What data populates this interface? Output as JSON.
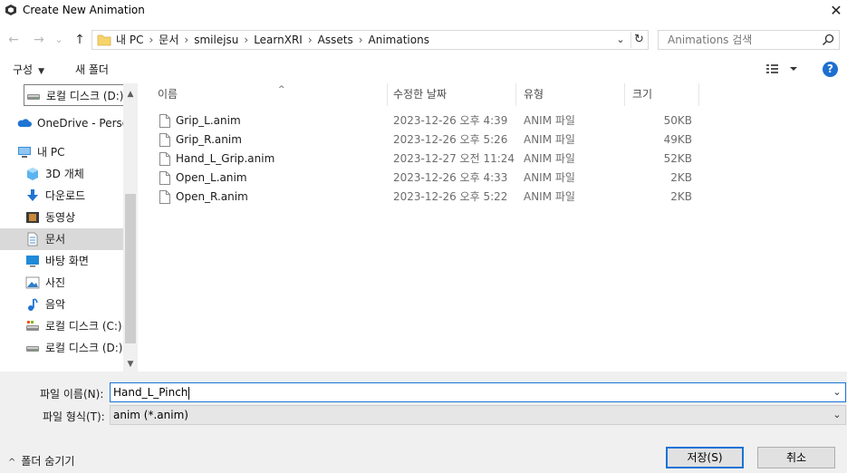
{
  "window": {
    "title": "Create New Animation",
    "close_glyph": "✕"
  },
  "nav": {
    "back_glyph": "←",
    "forward_glyph": "→",
    "recent_glyph": "⌄",
    "up_glyph": "↑",
    "breadcrumbs": [
      "내 PC",
      "문서",
      "smilejsu",
      "LearnXRI",
      "Assets",
      "Animations"
    ],
    "separator": "›",
    "dropdown_glyph": "⌄",
    "refresh_glyph": "↻",
    "search_placeholder": "Animations 검색"
  },
  "toolbar": {
    "organize_label": "구성",
    "organize_caret": "▼",
    "new_folder_label": "새 폴더",
    "help_label": "?"
  },
  "sidebar": {
    "items": [
      {
        "label": "로컬 디스크 (D:)",
        "icon": "drive-icon",
        "state": "hovered"
      },
      {
        "label": "OneDrive - Personal",
        "icon": "onedrive-icon",
        "state": ""
      },
      {
        "label": "내 PC",
        "icon": "pc-icon",
        "state": ""
      },
      {
        "label": "3D 개체",
        "icon": "3d-objects-icon",
        "state": ""
      },
      {
        "label": "다운로드",
        "icon": "download-icon",
        "state": ""
      },
      {
        "label": "동영상",
        "icon": "video-icon",
        "state": ""
      },
      {
        "label": "문서",
        "icon": "documents-icon",
        "state": "selected"
      },
      {
        "label": "바탕 화면",
        "icon": "desktop-icon",
        "state": ""
      },
      {
        "label": "사진",
        "icon": "pictures-icon",
        "state": ""
      },
      {
        "label": "음악",
        "icon": "music-icon",
        "state": ""
      },
      {
        "label": "로컬 디스크 (C:)",
        "icon": "drive-c-icon",
        "state": ""
      },
      {
        "label": "로컬 디스크 (D:)",
        "icon": "drive-icon",
        "state": ""
      }
    ],
    "scroll_up": "▲",
    "scroll_down": "▼"
  },
  "filelist": {
    "columns": [
      "이름",
      "수정한 날짜",
      "유형",
      "크기"
    ],
    "sort_glyph": "^",
    "files": [
      {
        "name": "Grip_L.anim",
        "date": "2023-12-26 오후 4:39",
        "type": "ANIM 파일",
        "size": "50KB"
      },
      {
        "name": "Grip_R.anim",
        "date": "2023-12-26 오후 5:26",
        "type": "ANIM 파일",
        "size": "49KB"
      },
      {
        "name": "Hand_L_Grip.anim",
        "date": "2023-12-27 오전 11:24",
        "type": "ANIM 파일",
        "size": "52KB"
      },
      {
        "name": "Open_L.anim",
        "date": "2023-12-26 오후 4:33",
        "type": "ANIM 파일",
        "size": "2KB"
      },
      {
        "name": "Open_R.anim",
        "date": "2023-12-26 오후 5:22",
        "type": "ANIM 파일",
        "size": "2KB"
      }
    ]
  },
  "bottom": {
    "filename_label": "파일 이름(N):",
    "filename_value": "Hand_L_Pinch",
    "filetype_label": "파일 형식(T):",
    "filetype_value": "anim (*.anim)",
    "dropdown_glyph": "⌄",
    "hide_folders_label": "폴더 숨기기",
    "hide_folders_chevron": "^",
    "save_label": "저장(S)",
    "cancel_label": "취소"
  },
  "colors": {
    "accent": "#1a73d6",
    "selected_bg": "#d9d9d9",
    "bottom_bg": "#f0f0f0"
  }
}
